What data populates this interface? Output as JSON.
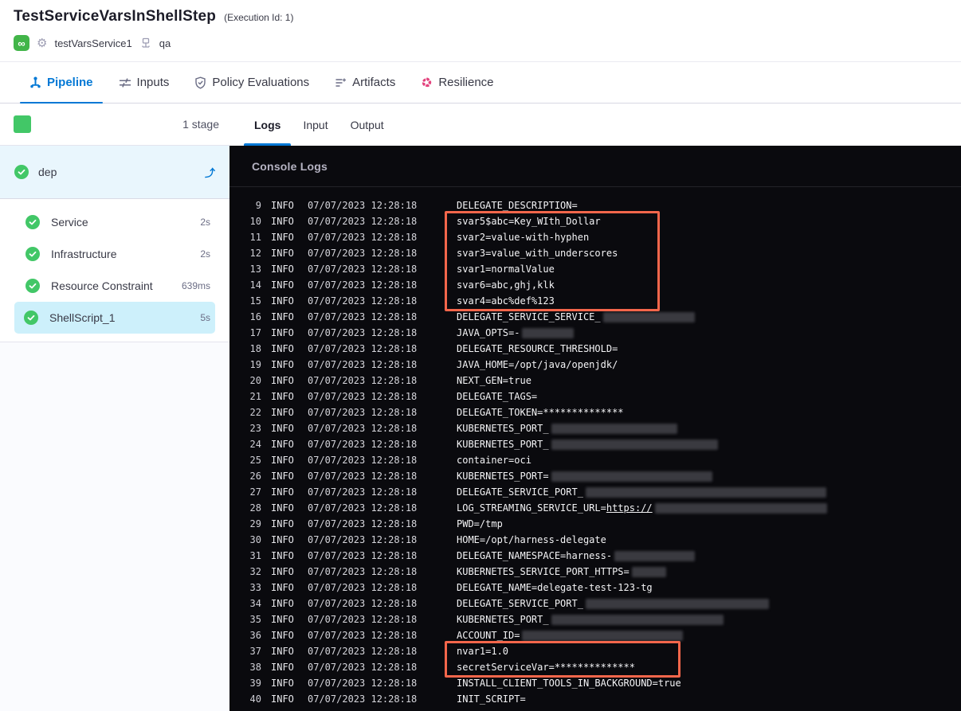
{
  "header": {
    "title": "TestServiceVarsInShellStep",
    "execution_id": "(Execution Id: 1)",
    "service_name": "testVarsService1",
    "environment_name": "qa"
  },
  "main_tabs": [
    {
      "label": "Pipeline",
      "icon": "pipeline-icon",
      "active": true
    },
    {
      "label": "Inputs",
      "icon": "inputs-icon",
      "active": false
    },
    {
      "label": "Policy Evaluations",
      "icon": "shield-check-icon",
      "active": false
    },
    {
      "label": "Artifacts",
      "icon": "artifacts-icon",
      "active": false
    },
    {
      "label": "Resilience",
      "icon": "resilience-icon",
      "active": false
    }
  ],
  "sidebar": {
    "stage_count": "1 stage",
    "group": {
      "name": "dep",
      "status": "success"
    },
    "steps": [
      {
        "label": "Service",
        "duration": "2s",
        "selected": false
      },
      {
        "label": "Infrastructure",
        "duration": "2s",
        "selected": false
      },
      {
        "label": "Resource Constraint",
        "duration": "639ms",
        "selected": false
      },
      {
        "label": "ShellScript_1",
        "duration": "5s",
        "selected": true
      }
    ]
  },
  "log_panel": {
    "tabs": [
      {
        "label": "Logs",
        "active": true
      },
      {
        "label": "Input",
        "active": false
      },
      {
        "label": "Output",
        "active": false
      }
    ],
    "console_title": "Console Logs",
    "level": "INFO",
    "timestamp": "07/07/2023 12:28:18",
    "highlight_color": "#f4664b",
    "highlights": [
      {
        "from_line": 10,
        "to_line": 15
      },
      {
        "from_line": 37,
        "to_line": 38
      }
    ],
    "lines": [
      {
        "n": 9,
        "text": "DELEGATE_DESCRIPTION="
      },
      {
        "n": 10,
        "text": "svar5$abc=Key_WIth_Dollar"
      },
      {
        "n": 11,
        "text": "svar2=value-with-hyphen"
      },
      {
        "n": 12,
        "text": "svar3=value_with_underscores"
      },
      {
        "n": 13,
        "text": "svar1=normalValue"
      },
      {
        "n": 14,
        "text": "svar6=abc,ghj,klk"
      },
      {
        "n": 15,
        "text": "svar4=abc%def%123"
      },
      {
        "n": 16,
        "text": "DELEGATE_SERVICE_SERVICE_",
        "redact_chars": 16
      },
      {
        "n": 17,
        "text": "JAVA_OPTS=-",
        "redact_chars": 9
      },
      {
        "n": 18,
        "text": "DELEGATE_RESOURCE_THRESHOLD="
      },
      {
        "n": 19,
        "text": "JAVA_HOME=/opt/java/openjdk/"
      },
      {
        "n": 20,
        "text": "NEXT_GEN=true"
      },
      {
        "n": 21,
        "text": "DELEGATE_TAGS="
      },
      {
        "n": 22,
        "text": "DELEGATE_TOKEN=**************"
      },
      {
        "n": 23,
        "text": "KUBERNETES_PORT_",
        "redact_chars": 22
      },
      {
        "n": 24,
        "text": "KUBERNETES_PORT_",
        "redact_chars": 29
      },
      {
        "n": 25,
        "text": "container=oci"
      },
      {
        "n": 26,
        "text": "KUBERNETES_PORT=",
        "redact_chars": 28
      },
      {
        "n": 27,
        "text": "DELEGATE_SERVICE_PORT_",
        "redact_chars": 42
      },
      {
        "n": 28,
        "text": "LOG_STREAMING_SERVICE_URL=",
        "link": "https://",
        "redact_chars": 30
      },
      {
        "n": 29,
        "text": "PWD=/tmp"
      },
      {
        "n": 30,
        "text": "HOME=/opt/harness-delegate"
      },
      {
        "n": 31,
        "text": "DELEGATE_NAMESPACE=harness-",
        "redact_chars": 14
      },
      {
        "n": 32,
        "text": "KUBERNETES_SERVICE_PORT_HTTPS=",
        "redact_chars": 6
      },
      {
        "n": 33,
        "text": "DELEGATE_NAME=delegate-test-123-tg"
      },
      {
        "n": 34,
        "text": "DELEGATE_SERVICE_PORT_",
        "redact_chars": 32
      },
      {
        "n": 35,
        "text": "KUBERNETES_PORT_",
        "redact_chars": 30
      },
      {
        "n": 36,
        "text": "ACCOUNT_ID=",
        "redact_chars": 28
      },
      {
        "n": 37,
        "text": "nvar1=1.0"
      },
      {
        "n": 38,
        "text": "secretServiceVar=**************"
      },
      {
        "n": 39,
        "text": "INSTALL_CLIENT_TOOLS_IN_BACKGROUND=true"
      },
      {
        "n": 40,
        "text": "INIT_SCRIPT="
      }
    ]
  }
}
